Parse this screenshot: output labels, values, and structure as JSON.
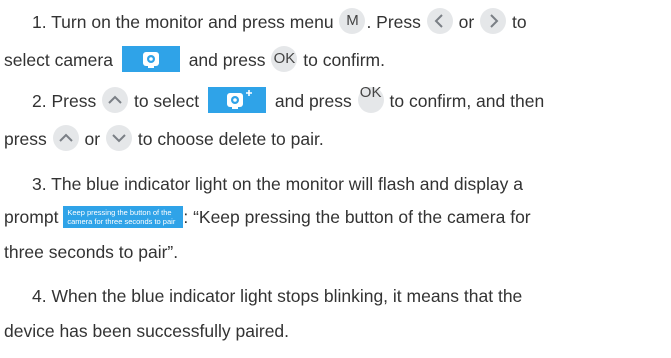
{
  "steps": {
    "s1": {
      "a": "1. Turn on the monitor and press menu",
      "menu_key": "M",
      "b": ". Press",
      "or": "or",
      "c": "to",
      "d": "select camera",
      "e": "and press",
      "ok_key": "OK",
      "f": "to confirm."
    },
    "s2": {
      "a": "2. Press",
      "b": "to select",
      "c": "and press",
      "ok_key": "OK",
      "d": "to confirm, and then",
      "e": "press",
      "or": "or",
      "f": "to choose delete to pair."
    },
    "s3": {
      "a": "3. The blue indicator light on the monitor will flash and display a",
      "b": "prompt",
      "prompt_text": "Keep pressing the button of the camera for three seconds to pair",
      "c": ": “Keep pressing the button of the camera for",
      "d": "three seconds to pair”."
    },
    "s4": {
      "a": "4. When the blue indicator light stops blinking, it means that the",
      "b": "device has been successfully paired."
    }
  },
  "colors": {
    "accent": "#2fa3e8",
    "key_bg": "#e5e7e9",
    "text": "#333333"
  },
  "icons": [
    "left-arrow-icon",
    "right-arrow-icon",
    "up-arrow-icon",
    "down-arrow-icon",
    "camera-icon",
    "camera-add-icon"
  ]
}
